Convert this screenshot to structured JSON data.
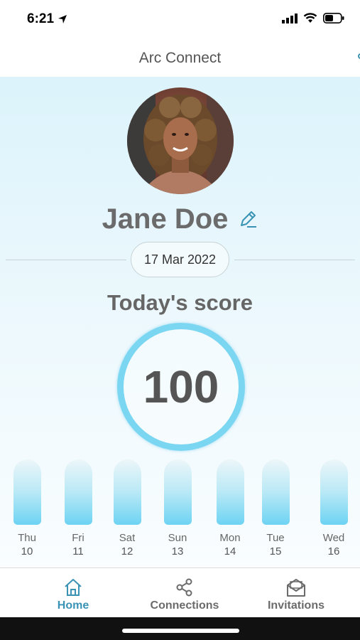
{
  "status_bar": {
    "time": "6:21"
  },
  "nav": {
    "title": "Arc Connect"
  },
  "profile": {
    "name": "Jane Doe",
    "date": "17 Mar 2022"
  },
  "score": {
    "label": "Today's score",
    "value": "100"
  },
  "colors": {
    "accent": "#3a93b5",
    "ring": "#7bd6f2",
    "bar": "#6dd3f3"
  },
  "days": [
    {
      "name": "Thu",
      "num": "10"
    },
    {
      "name": "Fri",
      "num": "11"
    },
    {
      "name": "Sat",
      "num": "12"
    },
    {
      "name": "Sun",
      "num": "13"
    },
    {
      "name": "Mon",
      "num": "14"
    },
    {
      "name": "Tue",
      "num": "15"
    },
    {
      "name": "Wed",
      "num": "16"
    }
  ],
  "tabs": [
    {
      "label": "Home",
      "icon": "home-icon",
      "active": true
    },
    {
      "label": "Connections",
      "icon": "share-icon",
      "active": false
    },
    {
      "label": "Invitations",
      "icon": "envelope-icon",
      "active": false
    }
  ]
}
